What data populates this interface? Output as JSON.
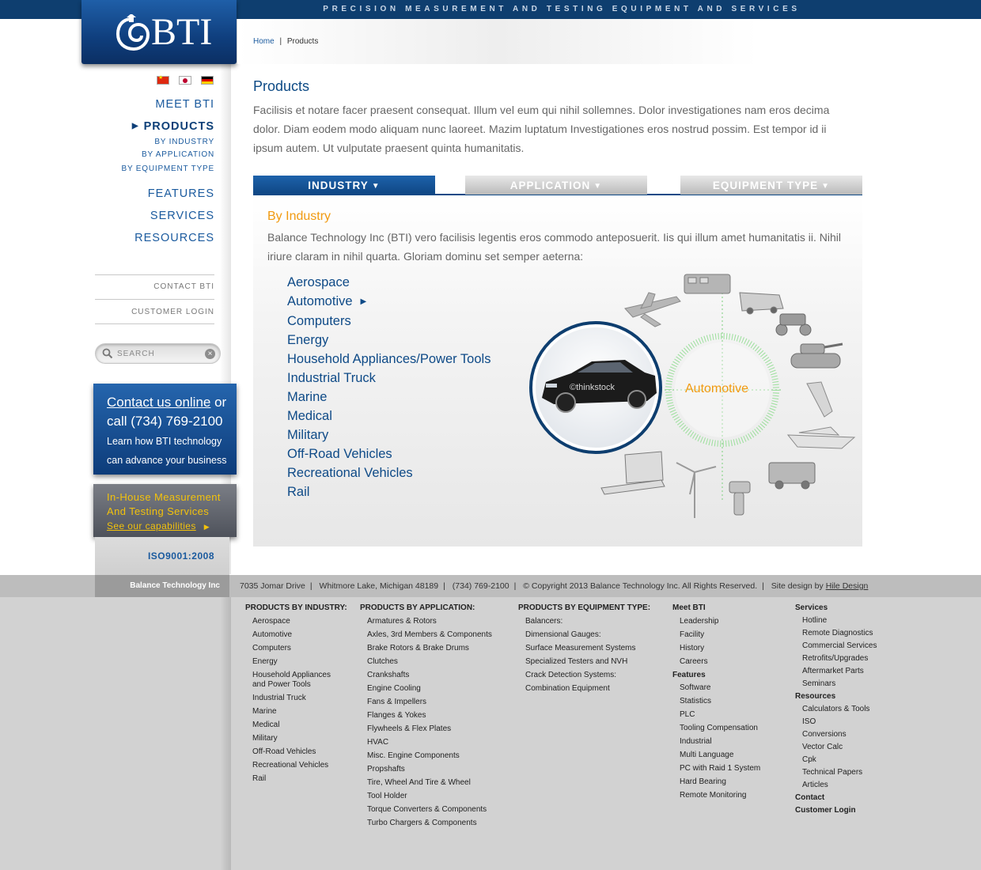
{
  "header": {
    "tagline": "PRECISION MEASUREMENT AND TESTING EQUIPMENT AND SERVICES",
    "logo_text": "BTI"
  },
  "breadcrumb": {
    "home": "Home",
    "separator": "|",
    "current": "Products"
  },
  "sidebar": {
    "nav": [
      {
        "label": "MEET BTI"
      },
      {
        "label": "PRODUCTS"
      },
      {
        "label": "FEATURES"
      },
      {
        "label": "SERVICES"
      },
      {
        "label": "RESOURCES"
      }
    ],
    "products_sub": [
      "BY INDUSTRY",
      "BY APPLICATION",
      "BY EQUIPMENT TYPE"
    ],
    "contact_link": "CONTACT BTI",
    "login_link": "CUSTOMER LOGIN",
    "search_placeholder": "SEARCH",
    "contact_box": {
      "link": "Contact us online",
      "or": " or",
      "phone": "call (734) 769-2100",
      "text1": "Learn how BTI technology",
      "text2": "can advance your business"
    },
    "inhouse": {
      "line1": "In-House Measurement",
      "line2": "And Testing Services",
      "link": "See our capabilities"
    },
    "iso": "ISO9001:2008"
  },
  "main": {
    "title": "Products",
    "intro": "Facilisis et notare facer praesent consequat. Illum vel eum qui nihil sollemnes. Dolor investigationes nam eros decima dolor. Diam eodem modo aliquam nunc laoreet. Mazim luptatum Investigationes eros nostrud possim. Est tempor id ii ipsum autem. Ut vulputate praesent quinta humanitatis.",
    "tabs": [
      {
        "label": "INDUSTRY"
      },
      {
        "label": "APPLICATION"
      },
      {
        "label": "EQUIPMENT TYPE"
      }
    ],
    "panel_title": "By Industry",
    "panel_desc": "Balance Technology Inc (BTI) vero facilisis legentis eros commodo anteposuerit. Iis qui illum amet humanitatis ii. Nihil iriure claram in nihil quarta. Gloriam dominu set semper aeterna:",
    "industries": [
      "Aerospace",
      "Automotive",
      "Computers",
      "Energy",
      "Household Appliances/Power Tools",
      "Industrial Truck",
      "Marine",
      "Medical",
      "Military",
      "Off-Road Vehicles",
      "Recreational Vehicles",
      "Rail"
    ],
    "selected_industry": "Automotive",
    "image_credit": "©thinkstock",
    "accent_color": "#f19a10",
    "brand_color": "#0e4a87"
  },
  "footer": {
    "company": "Balance Technology Inc",
    "address": "7035 Jomar Drive",
    "city": "Whitmore Lake, Michigan 48189",
    "phone": "(734) 769-2100",
    "copyright": "© Copyright 2013 Balance Technology Inc. All Rights Reserved.",
    "design_prefix": "Site design by",
    "design_link": "Hile Design",
    "sep": "|"
  },
  "sitemap": {
    "industry": {
      "head": "PRODUCTS BY INDUSTRY:",
      "items": [
        "Aerospace",
        "Automotive",
        "Computers",
        "Energy",
        "Household Appliances",
        "and Power Tools",
        "Industrial Truck",
        "Marine",
        "Medical",
        "Military",
        "Off-Road Vehicles",
        "Recreational Vehicles",
        "Rail"
      ]
    },
    "application": {
      "head": "PRODUCTS BY APPLICATION:",
      "items": [
        "Armatures & Rotors",
        "Axles, 3rd Members & Components",
        "Brake Rotors & Brake Drums",
        "Clutches",
        "Crankshafts",
        "Engine Cooling",
        "Fans & Impellers",
        "Flanges & Yokes",
        "Flywheels & Flex Plates",
        "HVAC",
        "Misc. Engine Components",
        "Propshafts",
        "Tire, Wheel And Tire & Wheel",
        "Tool Holder",
        "Torque Converters & Components",
        "Turbo Chargers & Components"
      ]
    },
    "equipment": {
      "head": "PRODUCTS BY EQUIPMENT TYPE:",
      "items": [
        "Balancers:",
        "Dimensional Gauges:",
        "Surface Measurement Systems",
        "Specialized Testers and NVH",
        "Crack Detection Systems:",
        "Combination Equipment"
      ]
    },
    "meet": {
      "head": "Meet BTI",
      "items": [
        "Leadership",
        "Facility",
        "History",
        "Careers"
      ],
      "features_head": "Features",
      "features": [
        "Software",
        "Statistics",
        "PLC",
        "Tooling Compensation",
        "Industrial",
        "Multi Language",
        "PC with Raid 1 System",
        "Hard Bearing",
        "Remote Monitoring"
      ]
    },
    "services": {
      "head": "Services",
      "items": [
        "Hotline",
        "Remote Diagnostics",
        "Commercial Services",
        "Retrofits/Upgrades",
        "Aftermarket Parts",
        "Seminars"
      ],
      "resources_head": "Resources",
      "resources": [
        "Calculators & Tools",
        "ISO",
        "Conversions",
        "Vector Calc",
        "Cpk",
        "Technical Papers",
        "Articles"
      ],
      "contact": "Contact",
      "login": "Customer Login"
    }
  }
}
